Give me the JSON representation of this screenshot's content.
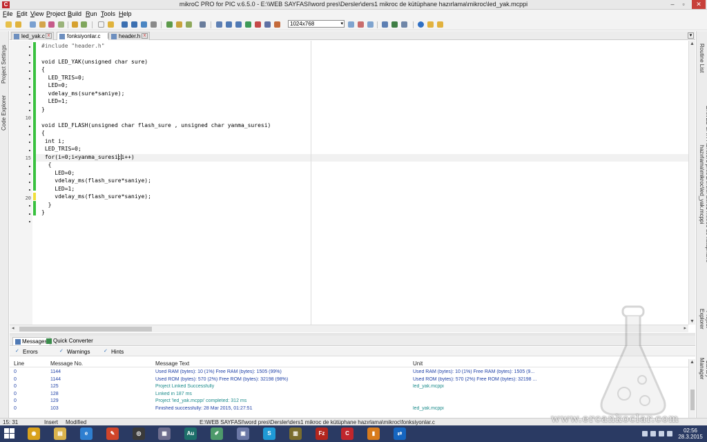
{
  "window": {
    "app_icon": "C",
    "title": "mikroC PRO for PIC v.6.5.0 - E:\\WEB SAYFASI\\word pres\\Dersler\\ders1 mikroc de kütüphane hazırlama\\mikroc\\led_yak.mcppi",
    "controls": {
      "minimize": "–",
      "maximize": "▫",
      "close": "✕"
    }
  },
  "menu": {
    "items": [
      {
        "pre": "",
        "u": "F",
        "post": "ile"
      },
      {
        "pre": "",
        "u": "E",
        "post": "dit"
      },
      {
        "pre": "",
        "u": "V",
        "post": "iew"
      },
      {
        "pre": "",
        "u": "P",
        "post": "roject"
      },
      {
        "pre": "",
        "u": "B",
        "post": "uild"
      },
      {
        "pre": "",
        "u": "R",
        "post": "un"
      },
      {
        "pre": "",
        "u": "T",
        "post": "ools"
      },
      {
        "pre": "",
        "u": "H",
        "post": "elp"
      }
    ]
  },
  "toolbar": {
    "resolution": "1024x768",
    "resolution_arrow": "▾"
  },
  "side_panels": {
    "left": [
      "Project Settings",
      "Code Explorer"
    ],
    "right": [
      "Routine List",
      "E:\\WEB SAYFASI\\word pres\\Dersler\\ders1 mikroc de kütüphane hazırlama\\mikroc\\led_yak.mcppi",
      "Project Explorer",
      "Library Manager"
    ]
  },
  "editor": {
    "tabs": [
      {
        "label": "led_yak.c",
        "close": "x"
      },
      {
        "label": "fonksiyonlar.c",
        "close": "x"
      },
      {
        "label": "header.h",
        "close": "x"
      }
    ],
    "tab_scroll": "▾",
    "line_numbers": [
      "10",
      "15",
      "20"
    ],
    "lines": [
      "#include \"header.h\"",
      "",
      "void LED_YAK(unsigned char sure)",
      "{",
      "  LED_TRIS=0;",
      "  LED=0;",
      "  vdelay_ms(sure*saniye);",
      "  LED=1;",
      "}",
      "",
      "void LED_FLASH(unsigned char flash_sure , unsigned char yanma_suresi)",
      "{",
      " int i;",
      " LED_TRIS=0;",
      " for(i=0;i<yanma_suresi;i++)",
      "  {",
      "    LED=0;",
      "    vdelay_ms(flash_sure*saniye);",
      "    LED=1;",
      "    vdelay_ms(flash_sure*saniye);",
      "  }",
      "}"
    ],
    "scroll_up": "▲",
    "scroll_down": "▼",
    "scroll_left": "◂",
    "scroll_right": "▸"
  },
  "bottom_panel": {
    "tabs": [
      "Messages",
      "Quick Converter"
    ],
    "filters": [
      {
        "label": "Errors",
        "check": "✓"
      },
      {
        "label": "Warnings",
        "check": "✓"
      },
      {
        "label": "Hints",
        "check": "✓"
      }
    ],
    "columns": [
      "Line",
      "Message No.",
      "Message Text",
      "Unit"
    ],
    "rows": [
      {
        "line": "0",
        "no": "1144",
        "text": "Used RAM (bytes): 10 (1%)  Free RAM (bytes): 1505 (99%)",
        "unit": "Used RAM (bytes): 10 (1%)  Free RAM (bytes): 1505 (9...",
        "style": "blue"
      },
      {
        "line": "0",
        "no": "1144",
        "text": "Used ROM (bytes): 570 (2%)  Free ROM (bytes): 32198 (98%)",
        "unit": "Used ROM (bytes): 570 (2%)  Free ROM (bytes): 32198 ...",
        "style": "blue"
      },
      {
        "line": "0",
        "no": "125",
        "text": "Project Linked Successfully",
        "unit": "led_yak.mcppi",
        "style": "teal"
      },
      {
        "line": "0",
        "no": "128",
        "text": "Linked in 187 ms",
        "unit": "",
        "style": "teal"
      },
      {
        "line": "0",
        "no": "129",
        "text": "Project 'led_yak.mcppi' completed: 312 ms",
        "unit": "",
        "style": "teal"
      },
      {
        "line": "0",
        "no": "103",
        "text": "Finished successfully: 28 Mar 2015, 01:27:51",
        "unit": "led_yak.mcppi",
        "style": "blue"
      }
    ],
    "scroll_up": "▲"
  },
  "status": {
    "position": "15: 31",
    "mode": "Insert",
    "state": "Modified",
    "file": "E:\\WEB SAYFASI\\word pres\\Dersler\\ders1 mikroc de kütüphane hazırlama\\mikroc\\fonksiyonlar.c"
  },
  "watermark": "www.ercankoclar.com",
  "taskbar": {
    "time": "02:56",
    "date": "28.3.2015",
    "icons": [
      {
        "name": "chrome",
        "glyph": "◉",
        "color": "#d9a21b"
      },
      {
        "name": "file-explorer",
        "glyph": "▤",
        "color": "#d9b24c"
      },
      {
        "name": "internet-explorer",
        "glyph": "e",
        "color": "#2f7fd0"
      },
      {
        "name": "paint-app",
        "glyph": "✎",
        "color": "#d0452a"
      },
      {
        "name": "obs-app",
        "glyph": "◎",
        "color": "#3a3a3a"
      },
      {
        "name": "media-app",
        "glyph": "▦",
        "color": "#6e6e8e"
      },
      {
        "name": "audition",
        "glyph": "Au",
        "color": "#1d6f6a"
      },
      {
        "name": "notepad",
        "glyph": "✐",
        "color": "#4e9a6b"
      },
      {
        "name": "installer",
        "glyph": "▣",
        "color": "#6b78a6"
      },
      {
        "name": "skype",
        "glyph": "S",
        "color": "#1f9ad6"
      },
      {
        "name": "chip-tool",
        "glyph": "▥",
        "color": "#7a6d2e"
      },
      {
        "name": "filezilla",
        "glyph": "Fz",
        "color": "#b3261e"
      },
      {
        "name": "mikroc",
        "glyph": "C",
        "color": "#c0262c"
      },
      {
        "name": "burner-app",
        "glyph": "▮",
        "color": "#d87b1c"
      },
      {
        "name": "teamviewer",
        "glyph": "⇄",
        "color": "#1565c0"
      }
    ]
  }
}
